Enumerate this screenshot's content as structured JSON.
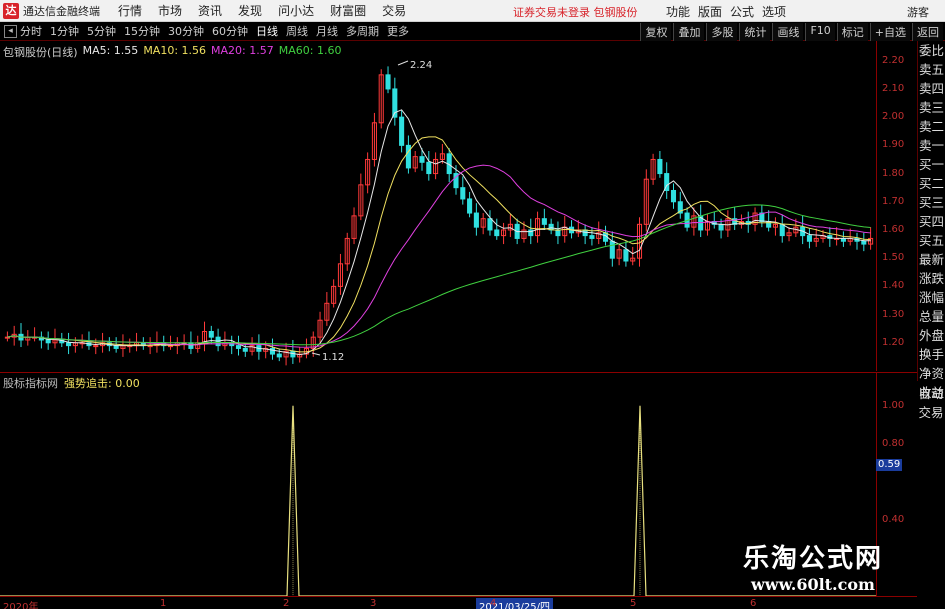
{
  "titlebar": {
    "app_title": "通达信金融终端",
    "menu": [
      "行情",
      "市场",
      "资讯",
      "发现",
      "问小达",
      "财富圈",
      "交易"
    ],
    "notice": "证券交易未登录  包钢股份",
    "right_buttons": [
      "功能",
      "版面",
      "公式",
      "选项"
    ],
    "guest": "游客"
  },
  "toolbar": {
    "periods": [
      "分时",
      "1分钟",
      "5分钟",
      "15分钟",
      "30分钟",
      "60分钟",
      "日线",
      "周线",
      "月线",
      "多周期",
      "更多"
    ],
    "active_period": "日线",
    "right_buttons": [
      "复权",
      "叠加",
      "多股",
      "统计",
      "画线",
      "F10",
      "标记",
      "+自选",
      "返回"
    ]
  },
  "main_legend": {
    "stock": "包钢股份(日线)",
    "ma5": "MA5: 1.55",
    "ma10": "MA10: 1.56",
    "ma20": "MA20: 1.57",
    "ma60": "MA60: 1.60"
  },
  "right_panel": [
    "委比",
    "卖五",
    "卖四",
    "卖三",
    "卖二",
    "卖一",
    "买一",
    "买二",
    "买三",
    "买四",
    "买五",
    "最新",
    "涨跌",
    "涨幅",
    "总量",
    "外盘",
    "换手",
    "净资",
    "收益"
  ],
  "sub_panel": [
    "自动",
    "交易"
  ],
  "sub_legend": {
    "name": "股标指标网",
    "series": "强势追击: 0.00"
  },
  "price_high_label": "2.24",
  "price_low_label": "1.12",
  "cursor_value": "0.59",
  "x_cursor": "2021/03/25/四",
  "colors": {
    "up": "#ff3a3a",
    "down": "#30e0e0",
    "ma5": "#e8e8e8",
    "ma10": "#f0e060",
    "ma20": "#e040e0",
    "ma60": "#40d040",
    "indicator": "#e8e080"
  },
  "chart_data": [
    {
      "type": "candlestick",
      "yticks": [
        1.2,
        1.3,
        1.4,
        1.5,
        1.6,
        1.7,
        1.8,
        1.9,
        2.0,
        2.1,
        2.2
      ],
      "ytick_labels": [
        "1.20",
        "1.30",
        "1.40",
        "1.50",
        "1.60",
        "1.70",
        "1.80",
        "1.90",
        "2.00",
        "2.10",
        "2.20"
      ],
      "xlabels": [
        "2020年",
        "1",
        "2",
        "3",
        "4",
        "5",
        "6"
      ],
      "ylim": [
        1.1,
        2.27
      ],
      "high": 2.24,
      "low": 1.12,
      "close": [
        1.22,
        1.23,
        1.21,
        1.22,
        1.22,
        1.21,
        1.2,
        1.21,
        1.2,
        1.19,
        1.2,
        1.2,
        1.19,
        1.19,
        1.2,
        1.19,
        1.18,
        1.19,
        1.19,
        1.2,
        1.19,
        1.19,
        1.2,
        1.19,
        1.19,
        1.2,
        1.2,
        1.18,
        1.2,
        1.24,
        1.22,
        1.19,
        1.2,
        1.19,
        1.18,
        1.17,
        1.19,
        1.17,
        1.18,
        1.16,
        1.15,
        1.17,
        1.15,
        1.16,
        1.18,
        1.22,
        1.28,
        1.34,
        1.4,
        1.48,
        1.57,
        1.65,
        1.76,
        1.85,
        1.98,
        2.15,
        2.1,
        2.0,
        1.9,
        1.82,
        1.86,
        1.84,
        1.8,
        1.85,
        1.87,
        1.8,
        1.75,
        1.71,
        1.66,
        1.61,
        1.64,
        1.6,
        1.58,
        1.6,
        1.62,
        1.57,
        1.6,
        1.58,
        1.64,
        1.62,
        1.6,
        1.58,
        1.61,
        1.59,
        1.6,
        1.58,
        1.57,
        1.59,
        1.56,
        1.5,
        1.53,
        1.49,
        1.5,
        1.62,
        1.78,
        1.85,
        1.8,
        1.74,
        1.7,
        1.66,
        1.61,
        1.65,
        1.6,
        1.63,
        1.62,
        1.6,
        1.64,
        1.62,
        1.63,
        1.62,
        1.66,
        1.63,
        1.61,
        1.62,
        1.58,
        1.59,
        1.61,
        1.58,
        1.56,
        1.57,
        1.58,
        1.57,
        1.57,
        1.56,
        1.57,
        1.56,
        1.55,
        1.57
      ]
    },
    {
      "type": "line",
      "series": [
        {
          "name": "强势追击",
          "values": [
            0,
            0,
            0,
            0,
            0,
            0,
            0,
            0,
            0,
            0,
            0,
            0,
            0,
            0,
            0,
            0,
            0,
            0,
            0,
            0,
            0,
            0,
            0,
            0,
            0,
            0,
            0,
            0,
            0,
            0,
            0,
            0,
            0,
            0,
            0,
            0,
            0,
            0,
            0,
            0,
            0,
            0,
            0,
            0,
            0,
            0,
            0,
            0,
            0,
            0,
            0,
            0,
            0,
            0,
            0,
            0,
            0,
            0,
            0,
            0,
            0,
            0,
            0,
            0,
            0,
            0,
            0,
            0,
            0,
            0,
            0,
            0,
            0,
            0,
            0,
            0,
            0,
            0,
            0,
            0,
            0,
            0,
            0,
            0,
            0,
            0,
            0,
            0,
            0,
            0,
            0,
            0,
            0,
            0,
            0,
            0,
            0,
            0,
            0,
            0,
            0,
            0,
            0,
            0,
            0,
            0,
            0,
            0,
            0,
            0,
            0,
            0,
            0,
            0,
            0,
            0,
            0,
            0,
            0,
            0,
            0,
            0,
            0,
            0,
            0,
            0,
            0,
            0
          ]
        }
      ],
      "spikes": [
        {
          "x_label": "2",
          "value": 1.0
        },
        {
          "x_label": "5",
          "value": 1.0
        }
      ],
      "yticks": [
        0.4,
        0.59,
        0.8,
        1.0
      ],
      "ytick_labels": [
        "0.40",
        "0.59",
        "0.80",
        "1.00"
      ],
      "ylim": [
        0,
        1.05
      ]
    }
  ],
  "watermark": {
    "line1": "乐淘公式网",
    "line2": "www.60lt.com"
  }
}
